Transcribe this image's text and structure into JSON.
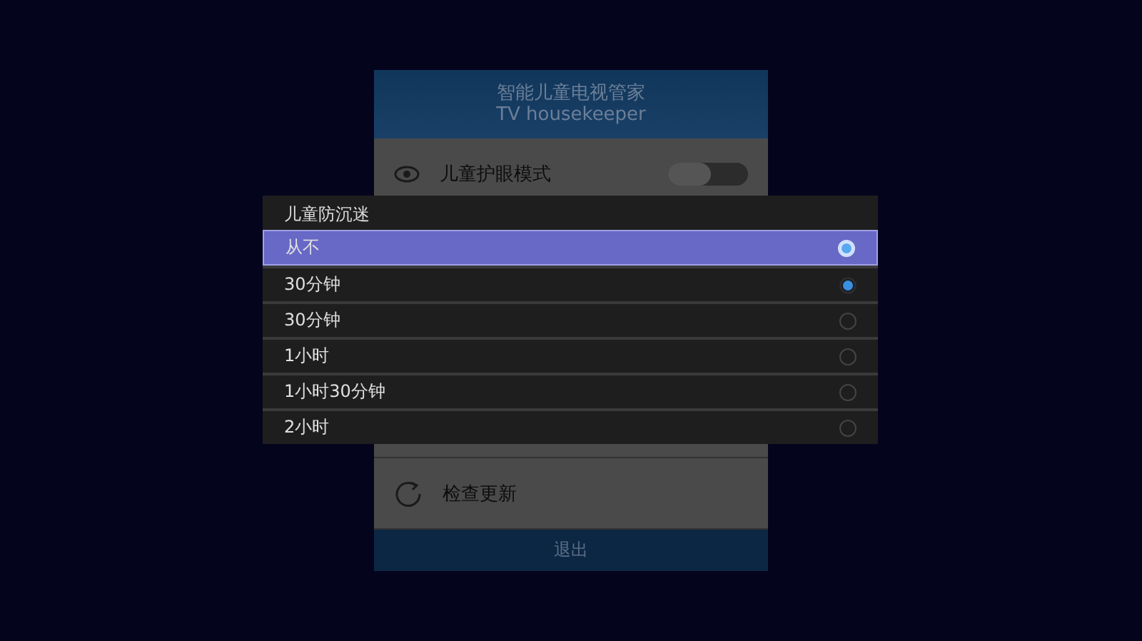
{
  "panel": {
    "title": "智能儿童电视管家",
    "subtitle": "TV housekeeper",
    "eye_mode": {
      "label": "儿童护眼模式",
      "on": false
    },
    "update": {
      "label": "检查更新"
    },
    "exit_button": "退出"
  },
  "dialog": {
    "title": "儿童防沉迷",
    "options": [
      {
        "label": "从不",
        "focused": true,
        "selected": true
      },
      {
        "label": "30分钟",
        "focused": false,
        "selected": true
      },
      {
        "label": "30分钟",
        "focused": false,
        "selected": false
      },
      {
        "label": "1小时",
        "focused": false,
        "selected": false
      },
      {
        "label": "1小时30分钟",
        "focused": false,
        "selected": false
      },
      {
        "label": "2小时",
        "focused": false,
        "selected": false
      }
    ]
  }
}
